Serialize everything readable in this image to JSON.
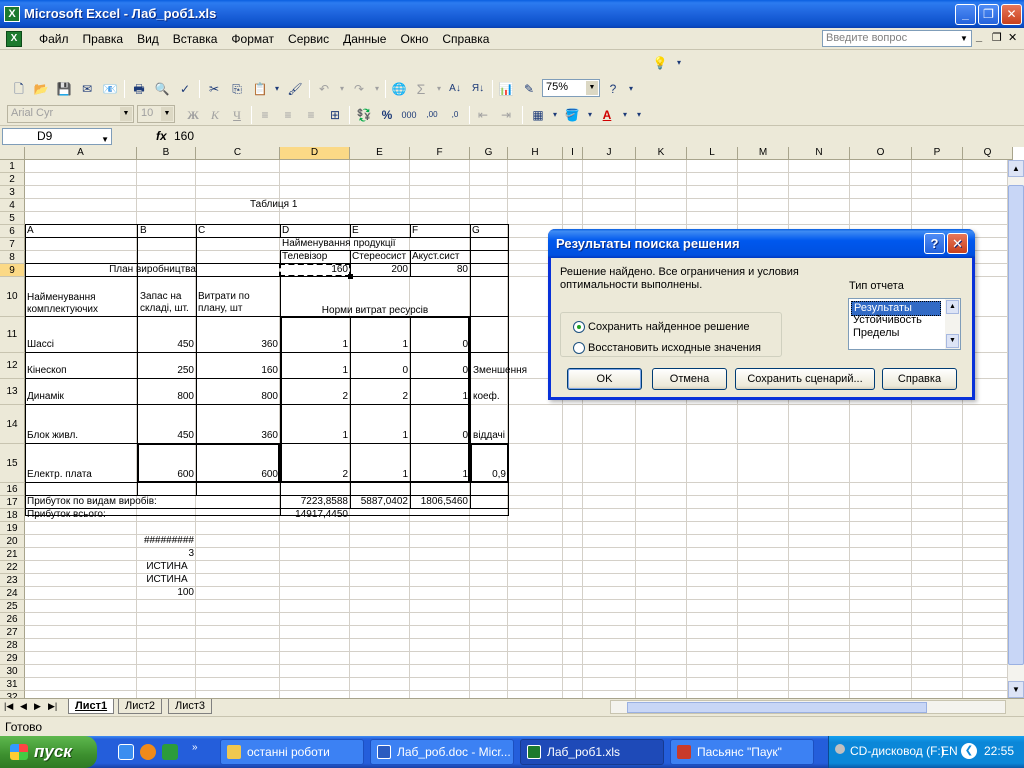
{
  "window": {
    "title": "Microsoft Excel - Лаб_роб1.xls"
  },
  "menu": [
    "Файл",
    "Правка",
    "Вид",
    "Вставка",
    "Формат",
    "Сервис",
    "Данные",
    "Окно",
    "Справка"
  ],
  "ask_box": {
    "placeholder": "Введите вопрос"
  },
  "toolbar": {
    "zoom": "75%",
    "font_name": "Arial Cyr",
    "font_size": "10"
  },
  "formula_bar": {
    "name_box": "D9",
    "fx": "fx",
    "value": "160"
  },
  "columns": [
    "A",
    "B",
    "C",
    "D",
    "E",
    "F",
    "G",
    "H",
    "I",
    "J",
    "K",
    "L",
    "M",
    "N",
    "O",
    "P",
    "Q"
  ],
  "rows": [
    "1",
    "2",
    "3",
    "4",
    "5",
    "6",
    "7",
    "8",
    "9",
    "10",
    "11",
    "12",
    "13",
    "14",
    "15",
    "16",
    "17",
    "18",
    "19",
    "20",
    "21",
    "22",
    "23",
    "24",
    "25",
    "26",
    "27",
    "28",
    "29",
    "30",
    "31",
    "32"
  ],
  "sheet": {
    "t_title": "Таблиця 1",
    "r6_a": "A",
    "r6_b": "B",
    "r6_c": "C",
    "r6_d": "D",
    "r6_e": "E",
    "r6_f": "F",
    "r6_g": "G",
    "r7_d": "Найменування продукції",
    "r8_d": "Телевізор",
    "r8_e": "Стереосист",
    "r8_f": "Акуст.сист",
    "r9_a": "План виробництва",
    "r9_d": "160",
    "r9_e": "200",
    "r9_f": "80",
    "r10_a": "Найменування комплектуючих",
    "r10_b": "Запас на складі, шт.",
    "r10_c": "Витрати по плану, шт",
    "r10_d": "Норми витрат ресурсів",
    "r11_a": "Шассі",
    "r11_b": "450",
    "r11_c": "360",
    "r11_d": "1",
    "r11_e": "1",
    "r11_f": "0",
    "r12_a": "Кінескоп",
    "r12_b": "250",
    "r12_c": "160",
    "r12_d": "1",
    "r12_e": "0",
    "r12_f": "0",
    "r12_g": "Зменшення",
    "r13_a": "Динамік",
    "r13_b": "800",
    "r13_c": "800",
    "r13_d": "2",
    "r13_e": "2",
    "r13_f": "1",
    "r13_g": "коеф.",
    "r14_a": "Блок живл.",
    "r14_b": "450",
    "r14_c": "360",
    "r14_d": "1",
    "r14_e": "1",
    "r14_f": "0",
    "r14_g": "віддачі",
    "r15_a": "Електр. плата",
    "r15_b": "600",
    "r15_c": "600",
    "r15_d": "2",
    "r15_e": "1",
    "r15_f": "1",
    "r15_g": "0,9",
    "r17_a": "Прибуток по видам виробів:",
    "r17_d": "7223,8588",
    "r17_e": "5887,0402",
    "r17_f": "1806,5460",
    "r18_a": "Прибуток всього:",
    "r18_d": "14917,4450",
    "r20_b": "#########",
    "r21_b": "3",
    "r22_b": "ИСТИНА",
    "r23_b": "ИСТИНА",
    "r24_b": "100"
  },
  "sheet_tabs": [
    "Лист1",
    "Лист2",
    "Лист3"
  ],
  "status": "Готово",
  "dialog": {
    "title": "Результаты поиска решения",
    "message": "Решение найдено. Все ограничения и условия оптимальности выполнены.",
    "report_type_label": "Тип отчета",
    "report_types": [
      "Результаты",
      "Устойчивость",
      "Пределы"
    ],
    "option_keep": "Сохранить найденное решение",
    "option_restore": "Восстановить исходные значения",
    "btn_ok": "OK",
    "btn_cancel": "Отмена",
    "btn_save_scenario": "Сохранить сценарий...",
    "btn_help": "Справка"
  },
  "taskbar": {
    "start": "пуск",
    "tasks": [
      "останні роботи",
      "Лаб_роб.doc - Micr...",
      "Лаб_роб1.xls",
      "Пасьянс \"Паук\""
    ],
    "cd_drive": "CD-дисковод (F:)",
    "lang": "EN",
    "clock": "22:55"
  }
}
